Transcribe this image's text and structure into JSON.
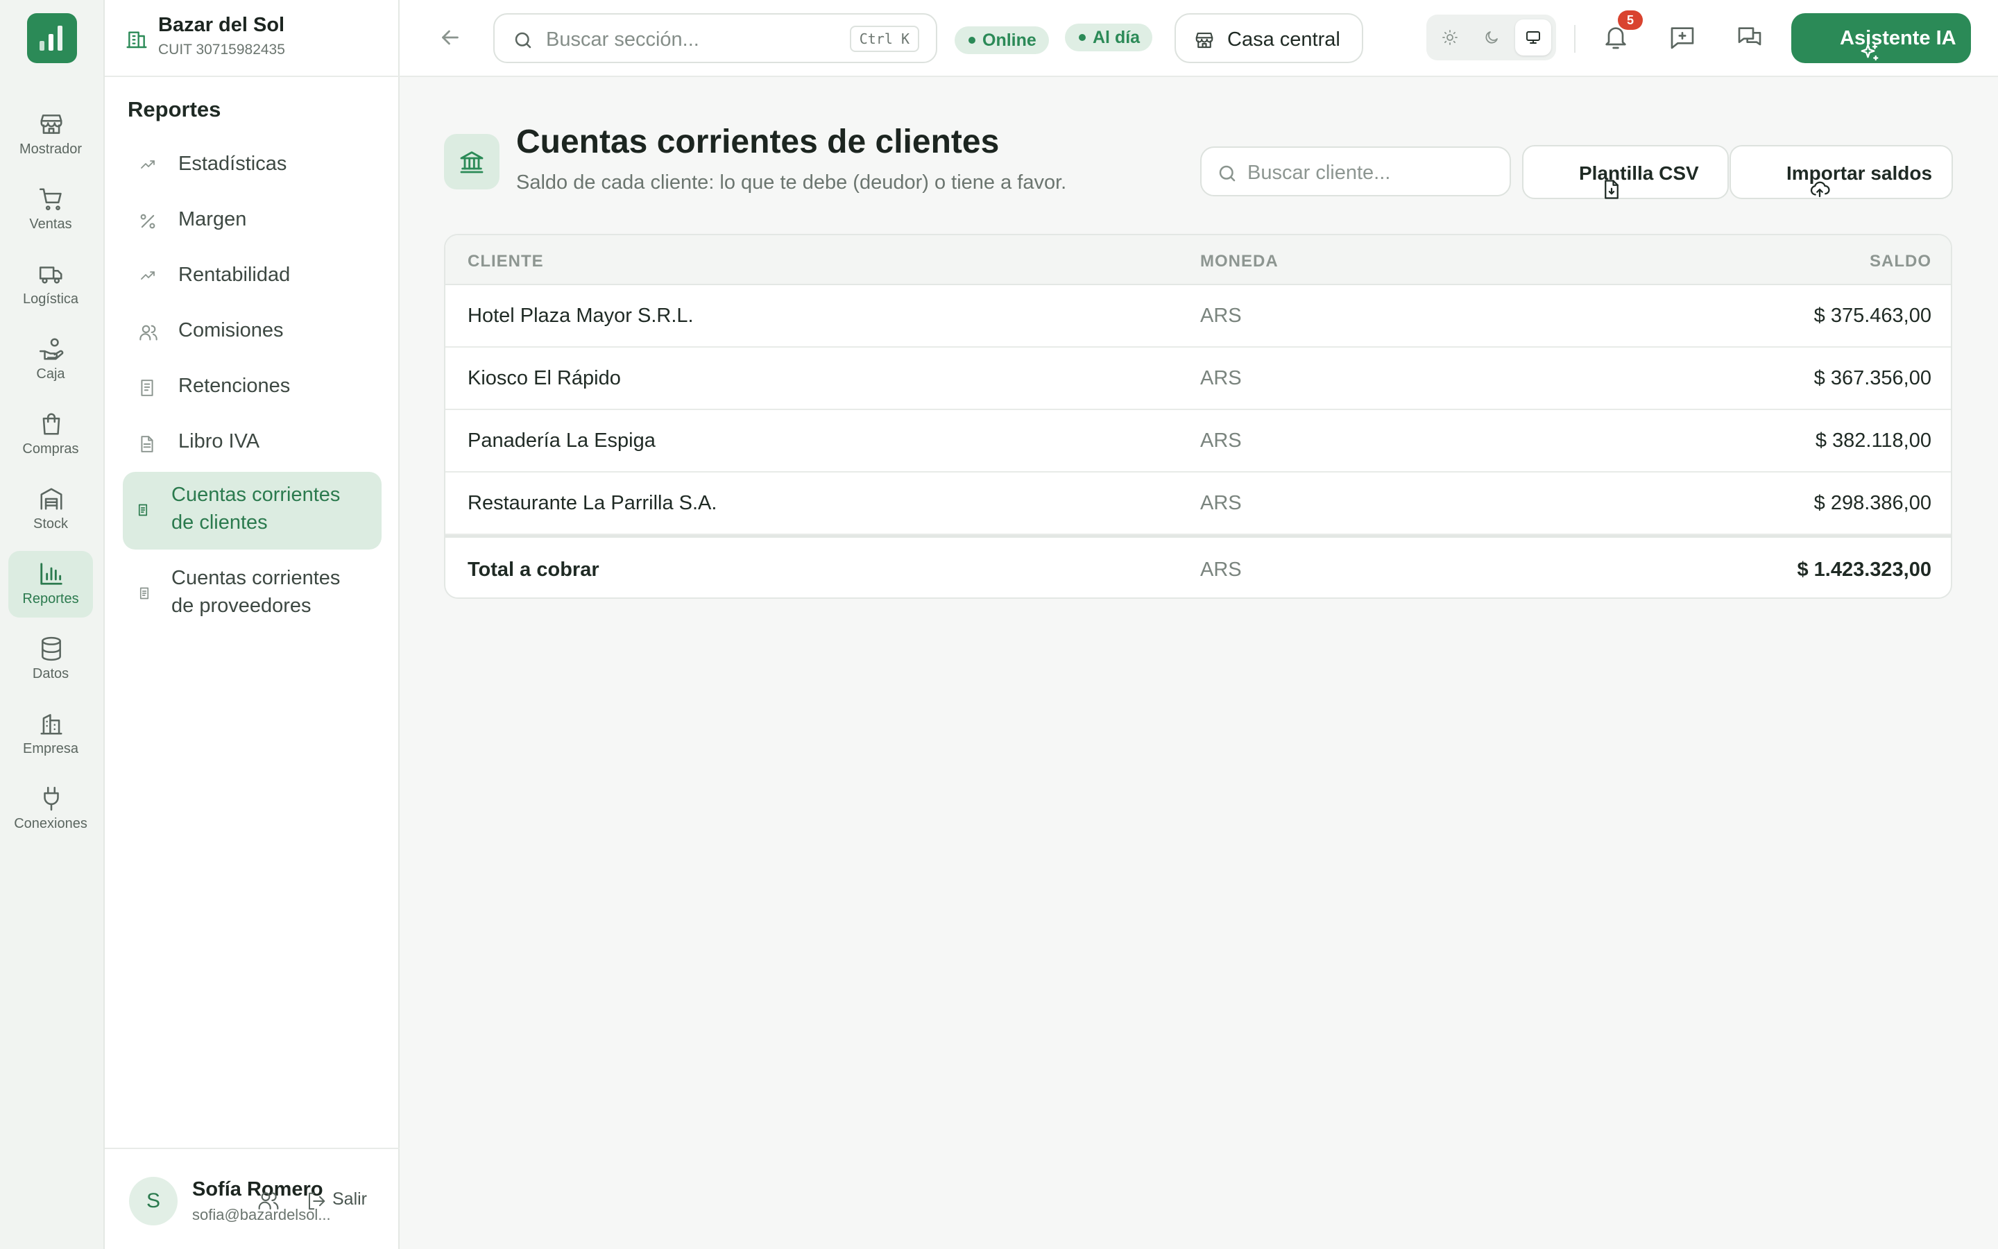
{
  "rail": {
    "items": [
      {
        "label": "Mostrador",
        "icon": "store-icon"
      },
      {
        "label": "Ventas",
        "icon": "cart-icon"
      },
      {
        "label": "Logística",
        "icon": "truck-icon"
      },
      {
        "label": "Caja",
        "icon": "hand-coins-icon"
      },
      {
        "label": "Compras",
        "icon": "shopping-bag-icon"
      },
      {
        "label": "Stock",
        "icon": "warehouse-icon"
      },
      {
        "label": "Reportes",
        "icon": "bar-chart-icon",
        "active": true
      },
      {
        "label": "Datos",
        "icon": "database-icon"
      },
      {
        "label": "Empresa",
        "icon": "building-icon"
      },
      {
        "label": "Conexiones",
        "icon": "plug-icon"
      }
    ]
  },
  "brand": {
    "name": "Bazar del Sol",
    "cuit": "CUIT 30715982435"
  },
  "sidebar": {
    "title": "Reportes",
    "items": [
      {
        "label": "Estadísticas",
        "icon": "trending-up-icon"
      },
      {
        "label": "Margen",
        "icon": "percent-icon"
      },
      {
        "label": "Rentabilidad",
        "icon": "trending-up-icon"
      },
      {
        "label": "Comisiones",
        "icon": "users-icon"
      },
      {
        "label": "Retenciones",
        "icon": "receipt-icon"
      },
      {
        "label": "Libro IVA",
        "icon": "file-text-icon"
      },
      {
        "label": "Cuentas corrientes de clientes",
        "icon": "ledger-icon",
        "active": true
      },
      {
        "label": "Cuentas corrientes de proveedores",
        "icon": "ledger-icon"
      }
    ]
  },
  "user": {
    "initial": "S",
    "name": "Sofía Romero",
    "email": "sofia@bazardelsol...",
    "logout": "Salir"
  },
  "topbar": {
    "search_placeholder": "Buscar sección...",
    "shortcut": "Ctrl K",
    "status_online": "Online",
    "status_sync": "Al día",
    "branch": "Casa central",
    "notifications_count": "5",
    "ai_button": "Asistente IA"
  },
  "page": {
    "title": "Cuentas corrientes de clientes",
    "subtitle": "Saldo de cada cliente: lo que te debe (deudor) o tiene a favor.",
    "search_placeholder": "Buscar cliente...",
    "csv_button": "Plantilla CSV",
    "import_button": "Importar saldos"
  },
  "table": {
    "headers": {
      "client": "CLIENTE",
      "currency": "MONEDA",
      "balance": "SALDO"
    },
    "rows": [
      {
        "client": "Hotel Plaza Mayor S.R.L.",
        "currency": "ARS",
        "balance": "$ 375.463,00"
      },
      {
        "client": "Kiosco El Rápido",
        "currency": "ARS",
        "balance": "$ 367.356,00"
      },
      {
        "client": "Panadería La Espiga",
        "currency": "ARS",
        "balance": "$ 382.118,00"
      },
      {
        "client": "Restaurante La Parrilla S.A.",
        "currency": "ARS",
        "balance": "$ 298.386,00"
      }
    ],
    "total": {
      "client": "Total a cobrar",
      "currency": "ARS",
      "balance": "$ 1.423.323,00"
    }
  },
  "colors": {
    "accent": "#2b8a57",
    "accent_soft": "#dcece1",
    "badge": "#d9432f"
  }
}
